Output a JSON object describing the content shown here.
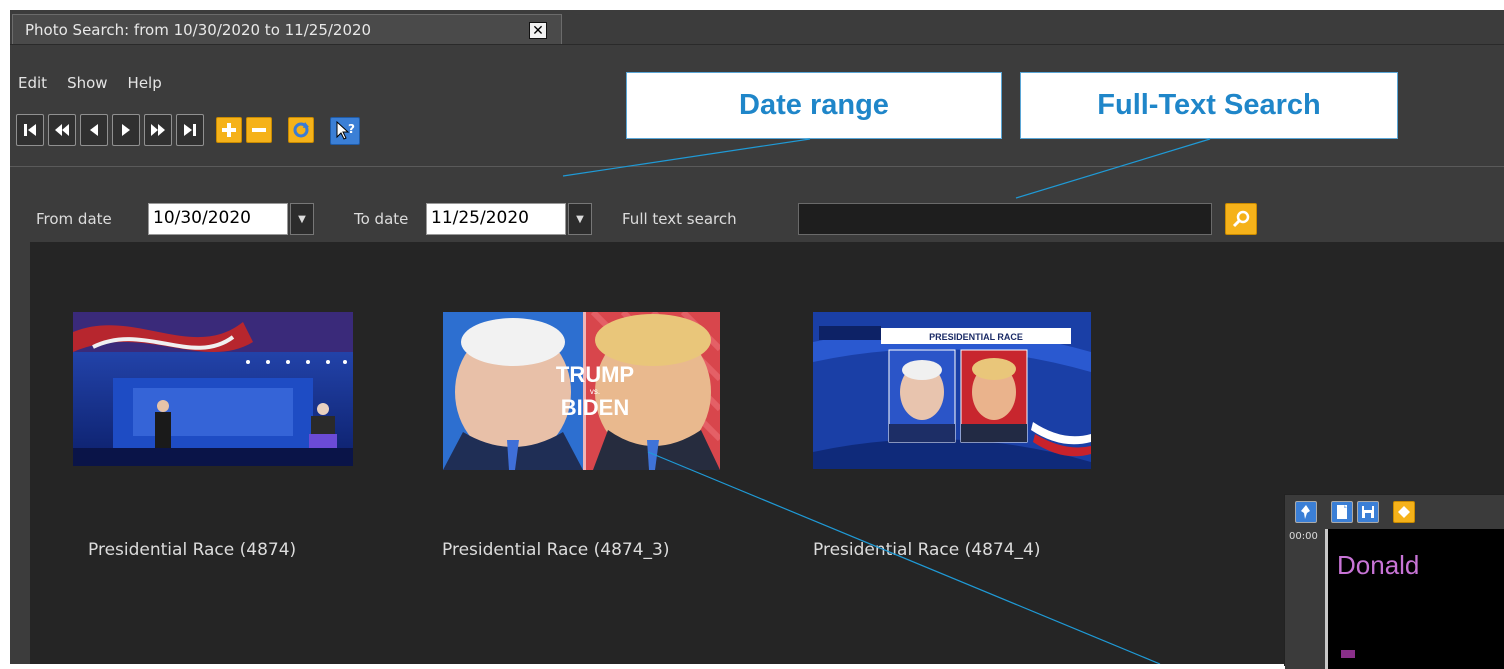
{
  "window": {
    "tab_title": "Photo Search: from 10/30/2020 to 11/25/2020",
    "close_glyph": "✕"
  },
  "menu": {
    "items": [
      "Edit",
      "Show",
      "Help"
    ]
  },
  "toolbar": {
    "buttons": [
      {
        "icon": "first-record-icon"
      },
      {
        "icon": "previous-page-icon"
      },
      {
        "icon": "previous-record-icon"
      },
      {
        "icon": "next-record-icon"
      },
      {
        "icon": "next-page-icon"
      },
      {
        "icon": "last-record-icon"
      },
      {
        "icon": "add-icon"
      },
      {
        "icon": "remove-icon"
      },
      {
        "icon": "refresh-icon"
      },
      {
        "icon": "help-cursor-icon"
      }
    ]
  },
  "callouts": {
    "date_range": "Date range",
    "full_text": "Full-Text Search"
  },
  "filter": {
    "from_label": "From date",
    "from_value": "10/30/2020",
    "to_label": "To date",
    "to_value": "11/25/2020",
    "search_label": "Full text search",
    "search_value": ""
  },
  "results": [
    {
      "caption": "Presidential Race (4874)",
      "image": "debate-stage-photo"
    },
    {
      "caption": "Presidential Race (4874_3)",
      "image": "trump-vs-biden-photo",
      "overlay_text": [
        "TRUMP",
        "vs.",
        "BIDEN"
      ]
    },
    {
      "caption": "Presidential Race (4874_4)",
      "image": "presidential-race-graphic-photo",
      "overlay_text": [
        "PRESIDENTIAL RACE"
      ]
    }
  ],
  "side_panel": {
    "time": "00:00",
    "name_text": "Donald"
  },
  "colors": {
    "app_bg": "#3c3c3c",
    "results_bg": "#252525",
    "accent_yellow": "#f5b21a",
    "accent_blue": "#3b7fd6",
    "callout_text": "#1f86c9",
    "leader_line": "#1f9ad6",
    "name_text": "#c874d6"
  }
}
